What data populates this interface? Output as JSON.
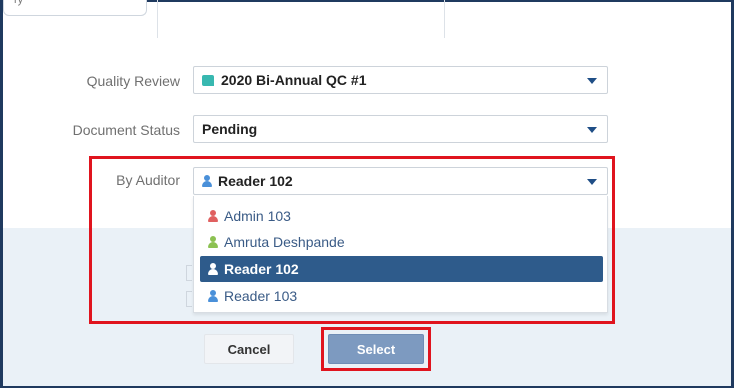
{
  "tab": {
    "label": "ry"
  },
  "form": {
    "quality_review": {
      "label": "Quality Review",
      "value": "2020 Bi-Annual QC #1"
    },
    "document_status": {
      "label": "Document Status",
      "value": "Pending"
    },
    "by_auditor": {
      "label": "By Auditor",
      "value": "Reader 102"
    }
  },
  "auditor_options": [
    {
      "label": "Admin 103",
      "icon": "user-icon",
      "color": "#e06060",
      "selected": false
    },
    {
      "label": "Amruta Deshpande",
      "icon": "user-icon",
      "color": "#8cc152",
      "selected": false
    },
    {
      "label": "Reader 102",
      "icon": "user-icon",
      "color": "#ffffff",
      "selected": true
    },
    {
      "label": "Reader 103",
      "icon": "user-icon",
      "color": "#4a90d9",
      "selected": false
    }
  ],
  "buttons": {
    "cancel": "Cancel",
    "select": "Select"
  },
  "colors": {
    "highlight": "#e0141e",
    "selected_row": "#2e5b8b",
    "select_button": "#7d9ac0",
    "outer_background": "#1f3a5f"
  }
}
